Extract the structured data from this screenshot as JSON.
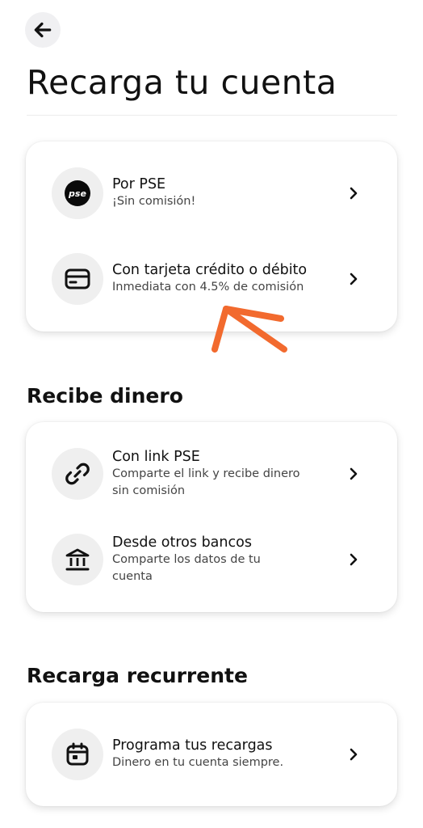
{
  "header": {
    "title": "Recarga tu cuenta"
  },
  "recarga": {
    "items": [
      {
        "title": "Por PSE",
        "subtitle": "¡Sin comisión!",
        "icon": "pse-logo-icon",
        "logo_text": "pse"
      },
      {
        "title": "Con tarjeta crédito o débito",
        "subtitle": "Inmediata con 4.5% de comisión",
        "icon": "credit-card-icon"
      }
    ]
  },
  "recibe": {
    "title": "Recibe dinero",
    "items": [
      {
        "title": "Con link PSE",
        "subtitle_1": "Comparte el link y recibe dinero",
        "subtitle_2": "sin comisión",
        "icon": "link-icon"
      },
      {
        "title": "Desde otros bancos",
        "subtitle_1": "Comparte los datos de tu",
        "subtitle_2": "cuenta",
        "icon": "bank-icon"
      }
    ]
  },
  "recurrente": {
    "title": "Recarga recurrente",
    "items": [
      {
        "title": "Programa tus recargas",
        "subtitle": "Dinero en tu cuenta siempre.",
        "icon": "calendar-icon"
      }
    ]
  },
  "colors": {
    "annotation": "#f26a2e",
    "card_bg": "#ffffff",
    "icon_bg": "#efefef"
  }
}
